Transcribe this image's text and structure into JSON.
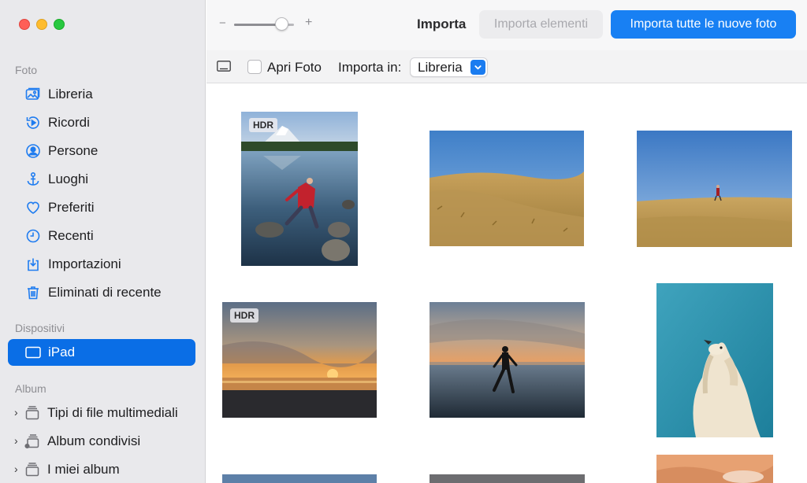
{
  "window": {
    "traffic_lights": {
      "close": "#fe5f57",
      "minimize": "#febc2e",
      "zoom": "#28c840"
    }
  },
  "sidebar": {
    "sections": {
      "photos": "Foto",
      "devices": "Dispositivi",
      "album": "Album"
    },
    "photo_items": [
      {
        "label": "Libreria",
        "icon": "photo-library-icon"
      },
      {
        "label": "Ricordi",
        "icon": "memories-icon"
      },
      {
        "label": "Persone",
        "icon": "people-icon"
      },
      {
        "label": "Luoghi",
        "icon": "places-icon"
      },
      {
        "label": "Preferiti",
        "icon": "heart-icon"
      },
      {
        "label": "Recenti",
        "icon": "clock-icon"
      },
      {
        "label": "Importazioni",
        "icon": "imports-icon"
      },
      {
        "label": "Eliminati di recente",
        "icon": "trash-icon"
      }
    ],
    "device_items": [
      {
        "label": "iPad",
        "icon": "ipad-icon",
        "selected": true
      }
    ],
    "album_items": [
      {
        "label": "Tipi di file multimediali",
        "icon": "stack-icon"
      },
      {
        "label": "Album condivisi",
        "icon": "shared-stack-icon"
      },
      {
        "label": "I miei album",
        "icon": "stack-icon"
      }
    ]
  },
  "toolbar": {
    "zoom": {
      "minus": "−",
      "plus": "+",
      "level": 0.8
    },
    "title": "Importa",
    "import_selected": "Importa elementi",
    "import_all": "Importa tutte le nuove foto"
  },
  "options": {
    "open_photos_label": "Apri Foto",
    "open_photos_checked": false,
    "import_into_label": "Importa in:",
    "import_into_value": "Libreria"
  },
  "photos": [
    {
      "id": "lake",
      "hdr": true,
      "hdr_label": "HDR"
    },
    {
      "id": "hill1",
      "hdr": false
    },
    {
      "id": "hill2",
      "hdr": false
    },
    {
      "id": "sunset",
      "hdr": true,
      "hdr_label": "HDR"
    },
    {
      "id": "beach",
      "hdr": false
    },
    {
      "id": "dog",
      "hdr": false
    }
  ],
  "colors": {
    "accent": "#1880f3",
    "selection": "#0a6ee6",
    "sidebar_icon": "#1f7cf0"
  }
}
